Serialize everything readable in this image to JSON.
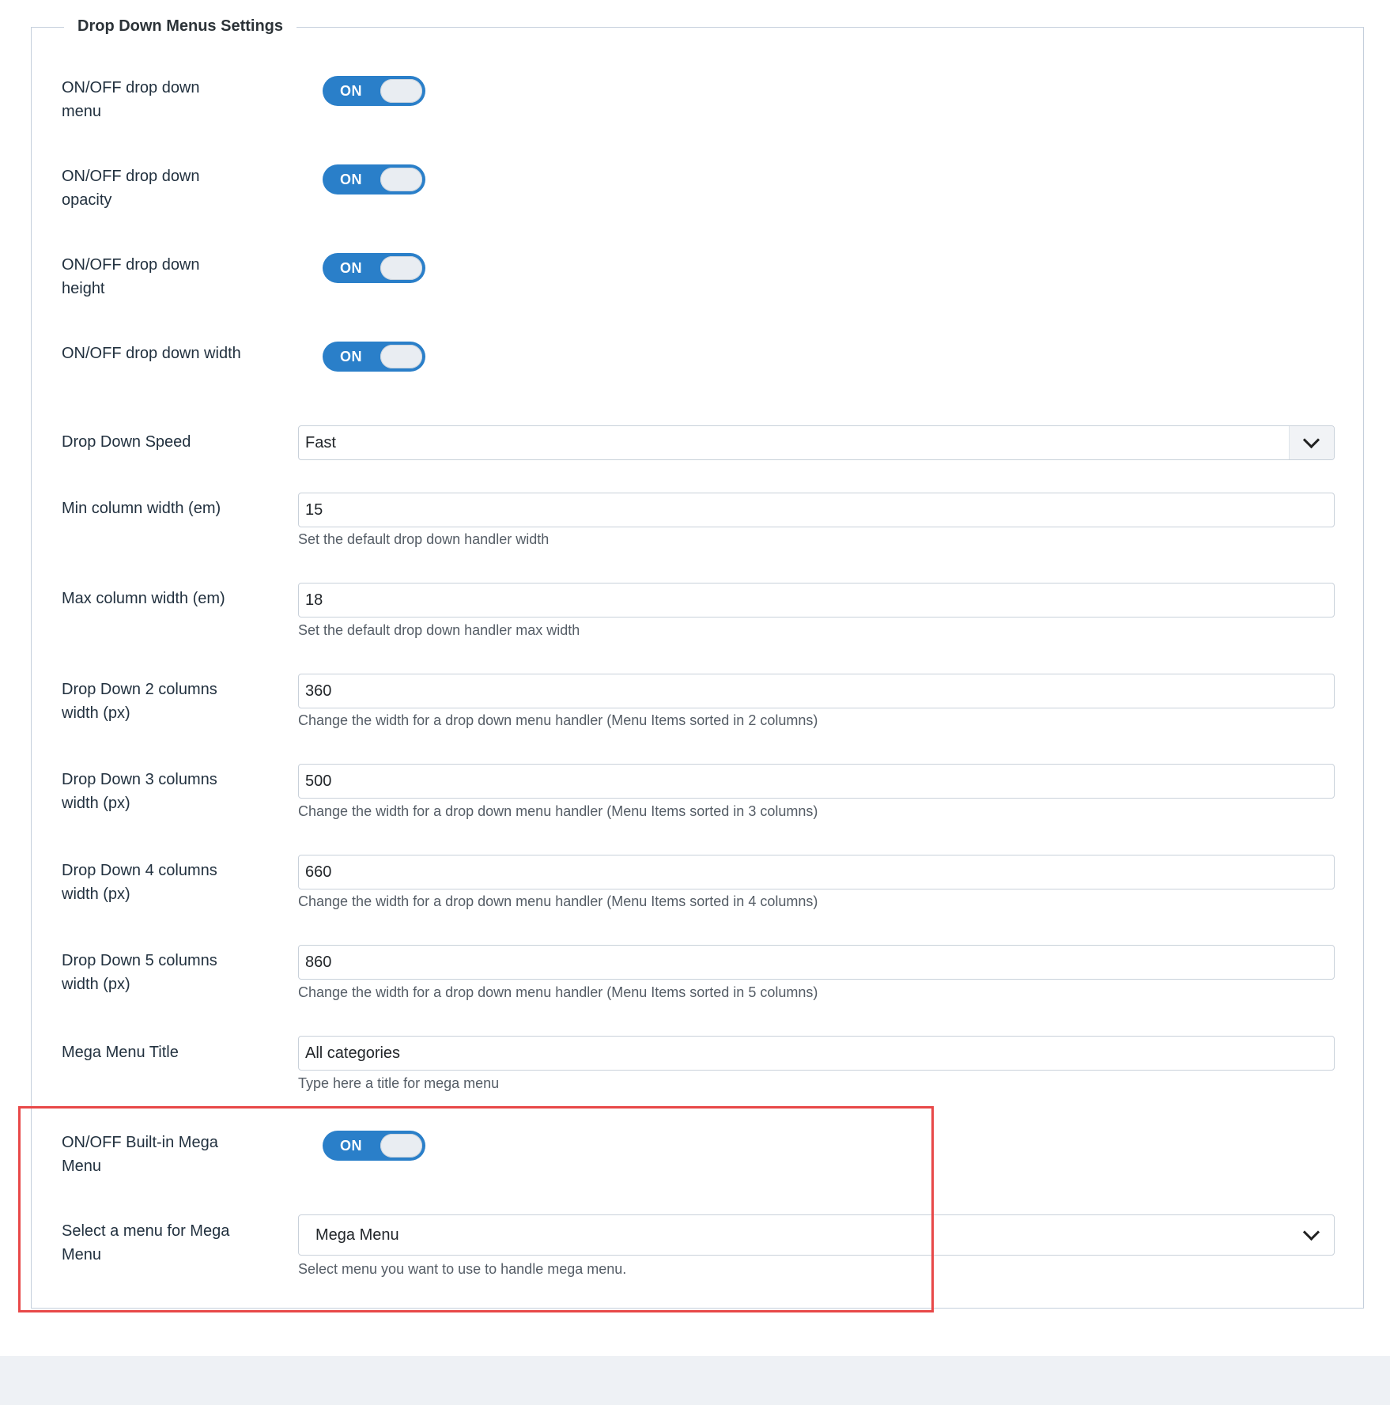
{
  "legend": "Drop Down Menus Settings",
  "toggle_on_label": "ON",
  "rows": {
    "dropdown_menu": {
      "label": "ON/OFF drop down menu",
      "state": "ON"
    },
    "dropdown_opacity": {
      "label": "ON/OFF drop down opacity",
      "state": "ON"
    },
    "dropdown_height": {
      "label": "ON/OFF drop down height",
      "state": "ON"
    },
    "dropdown_width": {
      "label": "ON/OFF drop down width",
      "state": "ON"
    },
    "speed": {
      "label": "Drop Down Speed",
      "value": "Fast"
    },
    "min_col": {
      "label": "Min column width (em)",
      "value": "15",
      "hint": "Set the default drop down handler width"
    },
    "max_col": {
      "label": "Max column width (em)",
      "value": "18",
      "hint": "Set the default drop down handler max width"
    },
    "col2": {
      "label": "Drop Down 2 columns width (px)",
      "value": "360",
      "hint": "Change the width for a drop down menu handler (Menu Items sorted in 2 columns)"
    },
    "col3": {
      "label": "Drop Down 3 columns width (px)",
      "value": "500",
      "hint": "Change the width for a drop down menu handler (Menu Items sorted in 3 columns)"
    },
    "col4": {
      "label": "Drop Down 4 columns width (px)",
      "value": "660",
      "hint": "Change the width for a drop down menu handler (Menu Items sorted in 4 columns)"
    },
    "col5": {
      "label": "Drop Down 5 columns width (px)",
      "value": "860",
      "hint": "Change the width for a drop down menu handler (Menu Items sorted in 5 columns)"
    },
    "mega_title": {
      "label": "Mega Menu Title",
      "value": "All categories",
      "hint": "Type here a title for mega menu"
    },
    "mega_toggle": {
      "label": "ON/OFF Built-in Mega Menu",
      "state": "ON"
    },
    "mega_select": {
      "label": "Select a menu for Mega Menu",
      "value": "Mega Menu",
      "hint": "Select menu you want to use to handle mega menu."
    }
  },
  "colors": {
    "toggle_on": "#2a7fc9",
    "highlight_border": "#e84848",
    "fieldset_border": "#c5cfdc"
  }
}
